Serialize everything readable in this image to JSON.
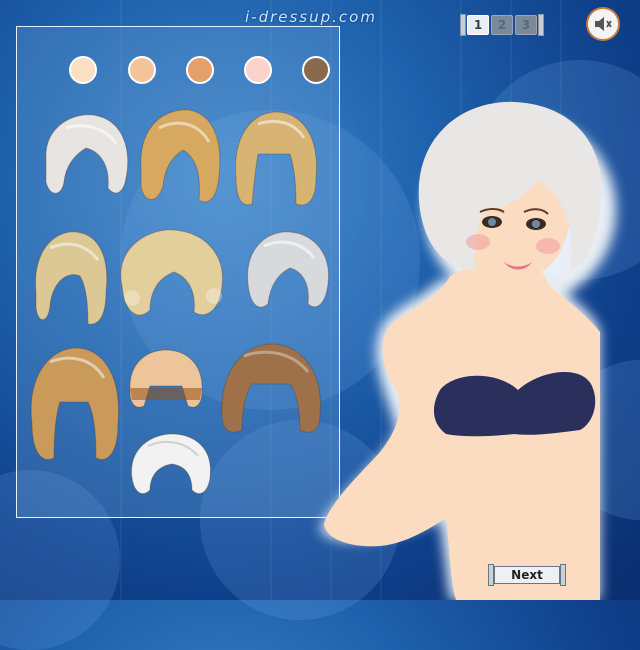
{
  "site": {
    "logo_text": "i-dressup.com"
  },
  "pages": [
    {
      "label": "1",
      "active": true
    },
    {
      "label": "2",
      "active": false
    },
    {
      "label": "3",
      "active": false
    }
  ],
  "sound_icon": "speaker-muted-icon",
  "skin_tones": [
    {
      "color": "#fbe0c4"
    },
    {
      "color": "#f3c49a"
    },
    {
      "color": "#e3a06a"
    },
    {
      "color": "#fbd3cc"
    },
    {
      "color": "#8a6a4e"
    }
  ],
  "hairstyles": [
    {
      "style": "platinum-bob-swoop",
      "color": "#e8e4e2"
    },
    {
      "style": "golden-bob",
      "color": "#d6a860"
    },
    {
      "style": "blonde-blunt-bob",
      "color": "#d8b474"
    },
    {
      "style": "blonde-side-sweep",
      "color": "#dcc894"
    },
    {
      "style": "curly-blonde",
      "color": "#e2cf9c"
    },
    {
      "style": "silver-shag",
      "color": "#d7d9dc"
    },
    {
      "style": "honey-bob",
      "color": "#c99a5a"
    },
    {
      "style": "two-tone-bob",
      "color": "#ecc69a"
    },
    {
      "style": "brown-bob",
      "color": "#9f714a"
    },
    {
      "style": "white-pixie",
      "color": "#f2f2f2"
    }
  ],
  "model": {
    "hair_color": "#e9e6e6",
    "skin_color": "#fbdcc0",
    "top_color": "#2a2f5c"
  },
  "next_button": {
    "label": "Next"
  }
}
